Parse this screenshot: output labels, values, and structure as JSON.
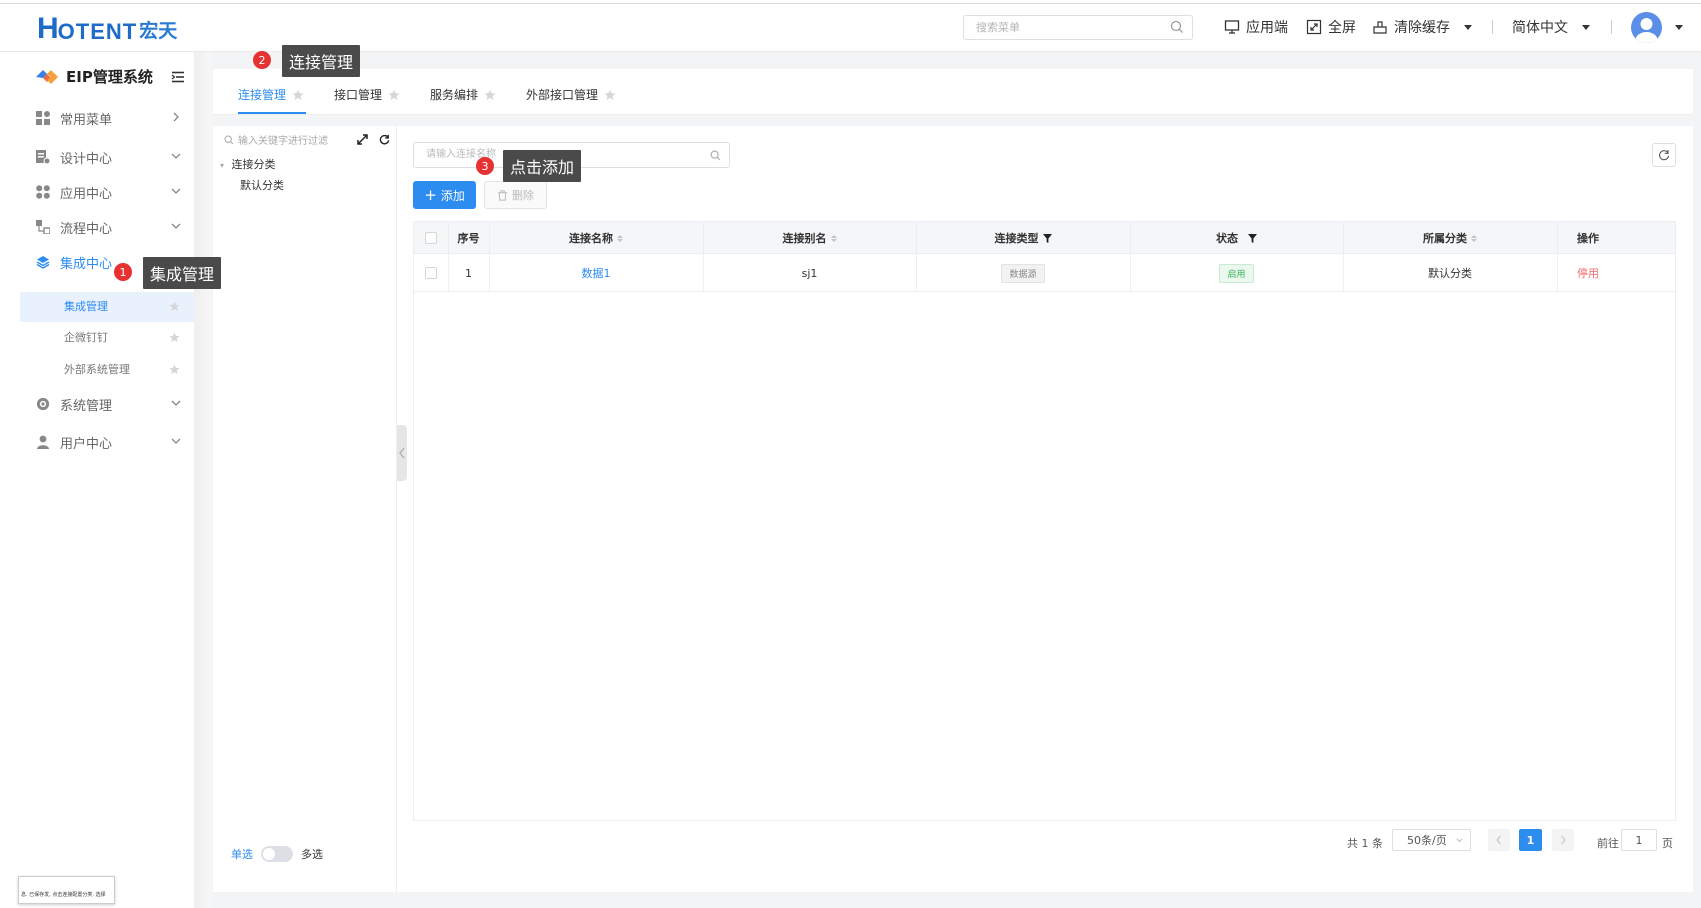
{
  "header": {
    "logo_h": "H",
    "logo_rest": "OTENT",
    "logo_cn": "宏天",
    "search_placeholder": "搜索菜单",
    "app_end": "应用端",
    "fullscreen": "全屏",
    "clear_cache": "清除缓存",
    "language": "简体中文"
  },
  "sidebar": {
    "system_name": "EIP管理系统",
    "groups": [
      {
        "label": "常用菜单",
        "icon": "grid-icon"
      },
      {
        "label": "设计中心",
        "icon": "design-icon"
      },
      {
        "label": "应用中心",
        "icon": "apps-icon"
      },
      {
        "label": "流程中心",
        "icon": "flow-icon"
      },
      {
        "label": "集成中心",
        "icon": "layers-icon"
      },
      {
        "label": "系统管理",
        "icon": "gear-icon"
      },
      {
        "label": "用户中心",
        "icon": "user-icon"
      }
    ],
    "subitems": [
      "集成管理",
      "企微钉钉",
      "外部系统管理"
    ]
  },
  "tabs": [
    "连接管理",
    "接口管理",
    "服务编排",
    "外部接口管理"
  ],
  "tree": {
    "search_placeholder": "输入关键字进行过滤",
    "root": "连接分类",
    "child": "默认分类"
  },
  "toolbar": {
    "search_placeholder": "请输入连接名称",
    "add": "添加",
    "delete": "删除"
  },
  "table": {
    "headers": [
      "序号",
      "连接名称",
      "连接别名",
      "连接类型",
      "状态",
      "所属分类",
      "操作"
    ],
    "rows": [
      {
        "index": "1",
        "name": "数据1",
        "alias": "sj1",
        "type": "数据源",
        "status": "启用",
        "category": "默认分类",
        "action": "停用"
      }
    ]
  },
  "pagination": {
    "total": "共 1 条",
    "page_size": "50条/页",
    "current": "1",
    "goto_label": "前往",
    "goto_value": "1",
    "page_suffix": "页"
  },
  "select_mode": {
    "single": "单选",
    "multi": "多选"
  },
  "callouts": [
    {
      "num": "1",
      "text": "集成管理"
    },
    {
      "num": "2",
      "text": "连接管理"
    },
    {
      "num": "3",
      "text": "点击添加"
    }
  ],
  "thumbnail_text": "息. 已保存发, 点击连接配置分类. 选择",
  "colors": {
    "accent": "#2d8cf0",
    "callout": "#e63232",
    "danger": "#f56c6c",
    "success": "#3ab35a"
  }
}
